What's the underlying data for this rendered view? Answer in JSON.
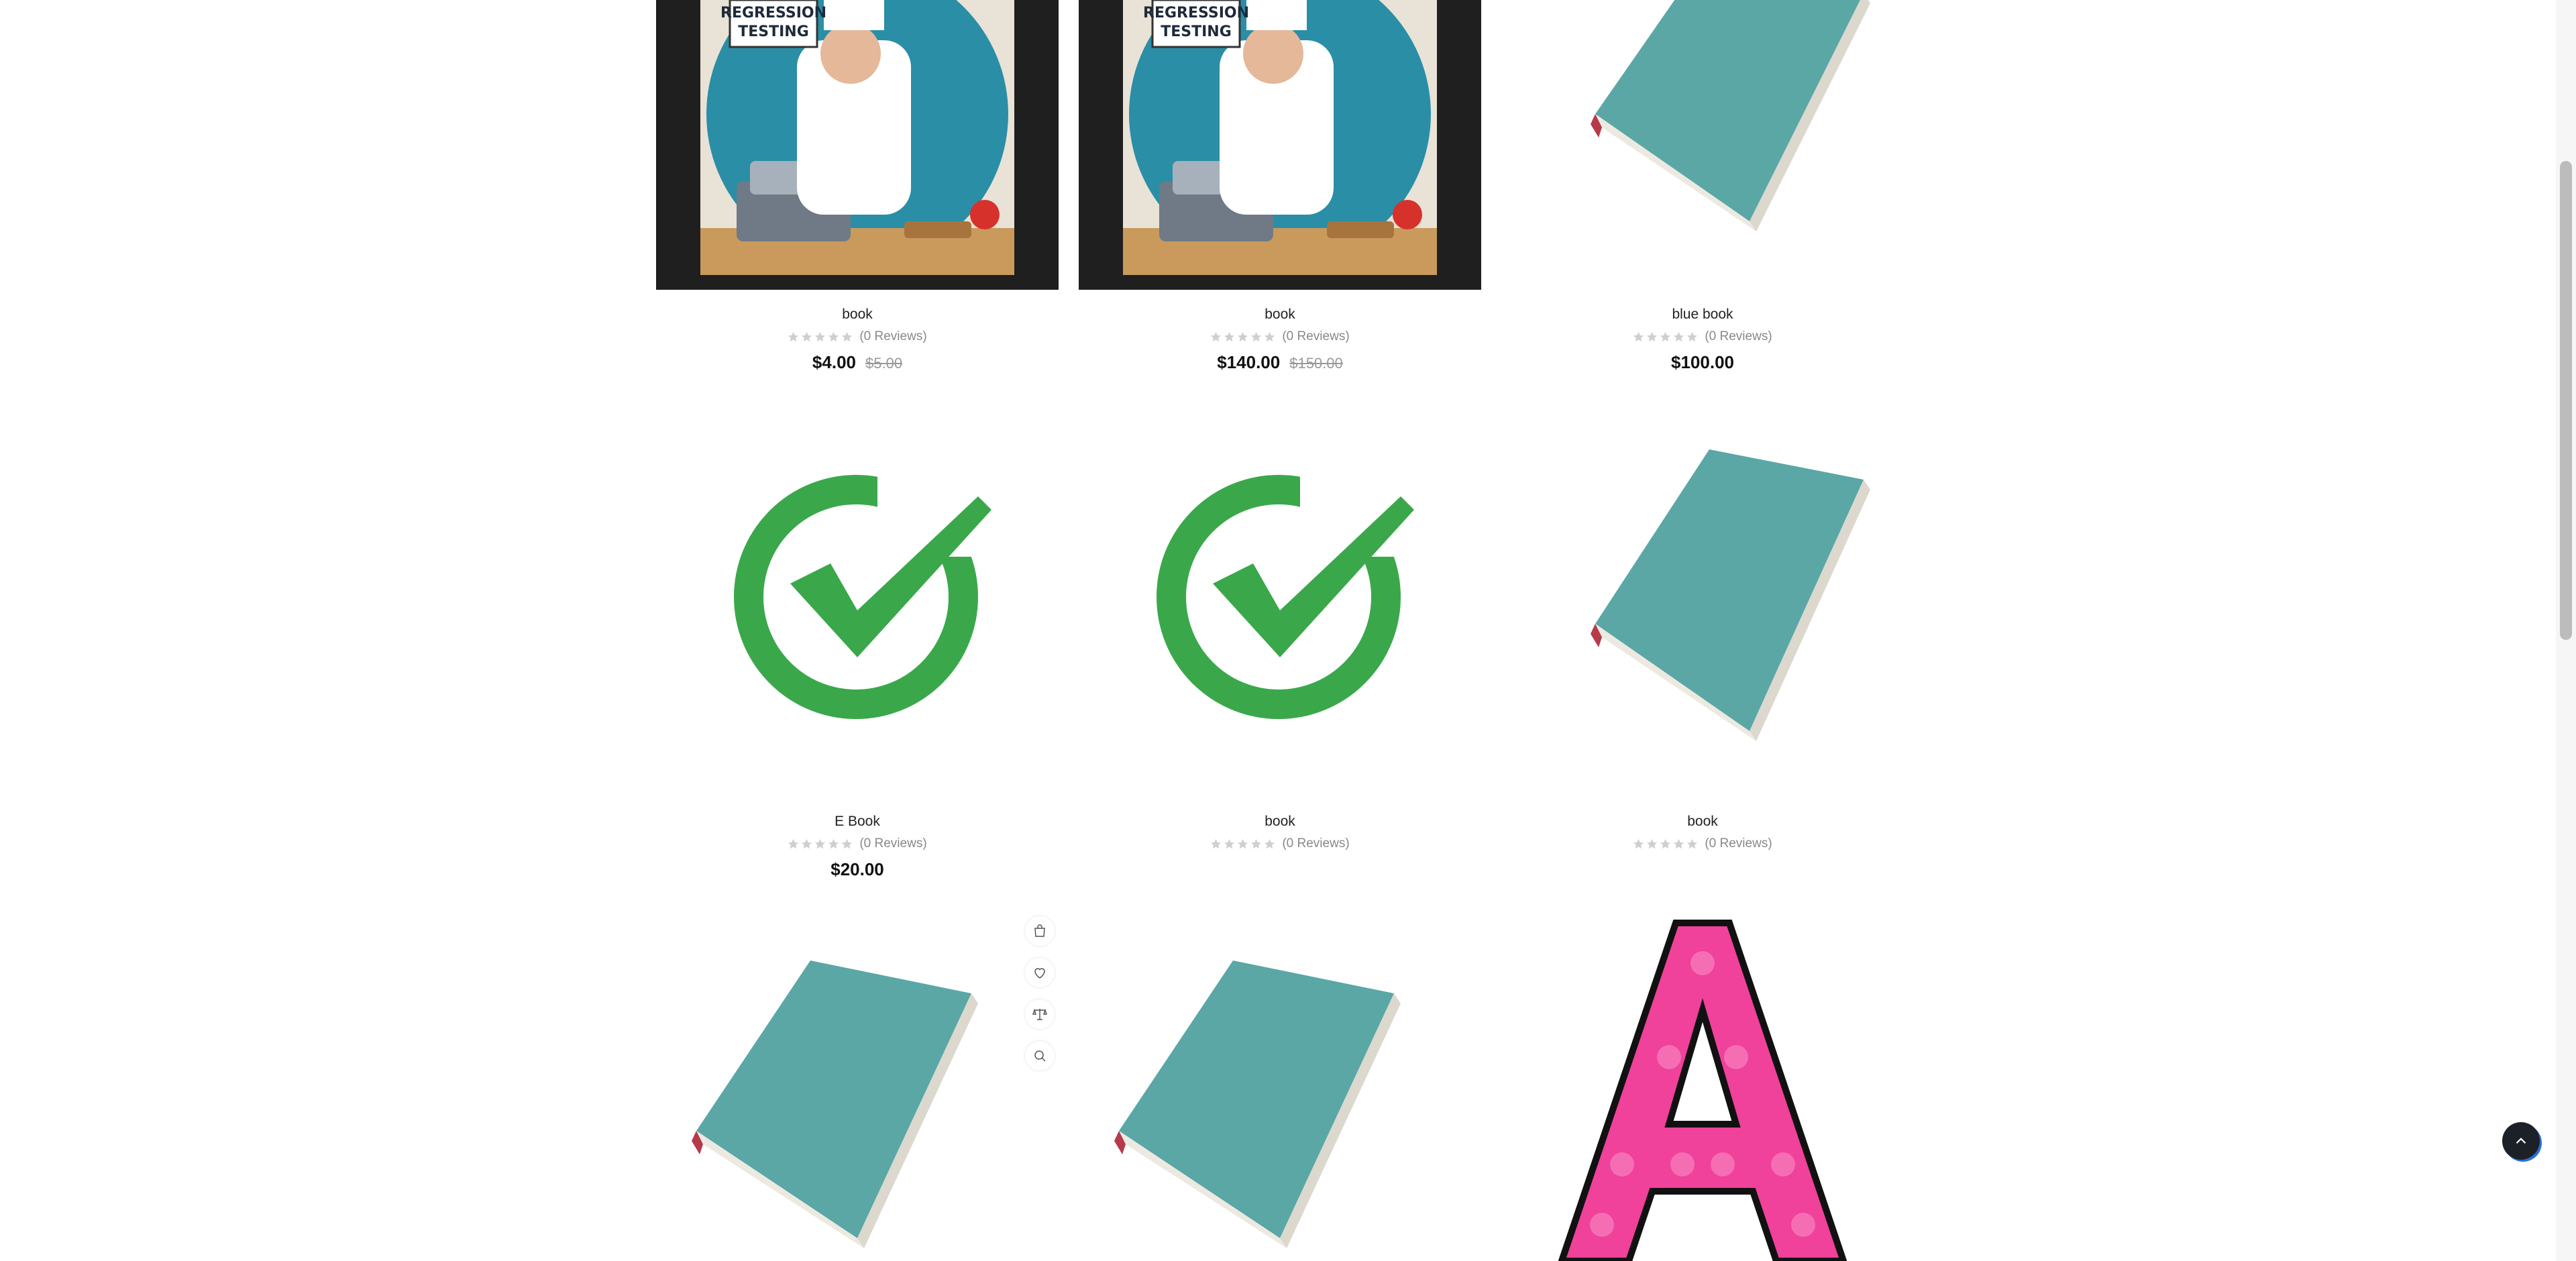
{
  "products": [
    {
      "title": "book",
      "reviews": "(0 Reviews)",
      "price": "$4.00",
      "old_price": "$5.00",
      "image": "regression-testing-chef"
    },
    {
      "title": "book",
      "reviews": "(0 Reviews)",
      "price": "$140.00",
      "old_price": "$150.00",
      "image": "regression-testing-chef"
    },
    {
      "title": "blue book",
      "reviews": "(0 Reviews)",
      "price": "$100.00",
      "old_price": "",
      "image": "teal-book"
    },
    {
      "title": "E Book",
      "reviews": "(0 Reviews)",
      "price": "$20.00",
      "old_price": "",
      "image": "green-check"
    },
    {
      "title": "book",
      "reviews": "(0 Reviews)",
      "price": "",
      "old_price": "",
      "image": "green-check"
    },
    {
      "title": "book",
      "reviews": "(0 Reviews)",
      "price": "",
      "old_price": "",
      "image": "teal-book"
    },
    {
      "title": "",
      "reviews": "",
      "price": "",
      "old_price": "",
      "image": "teal-book"
    },
    {
      "title": "",
      "reviews": "",
      "price": "",
      "old_price": "",
      "image": "teal-book"
    },
    {
      "title": "",
      "reviews": "",
      "price": "",
      "old_price": "",
      "image": "pink-letter-a"
    }
  ],
  "poster": {
    "sign_line1": "REGRESSION",
    "sign_line2": "TESTING"
  },
  "letter_a": "A",
  "hover_actions": [
    "cart-icon",
    "heart-icon",
    "compare-icon",
    "zoom-icon"
  ],
  "colors": {
    "check_green": "#3aa84a",
    "book_teal": "#5aa7a6",
    "letter_pink": "#f0419b",
    "to_top_bg": "#1c2128",
    "to_top_ring": "#2b6fd6"
  }
}
